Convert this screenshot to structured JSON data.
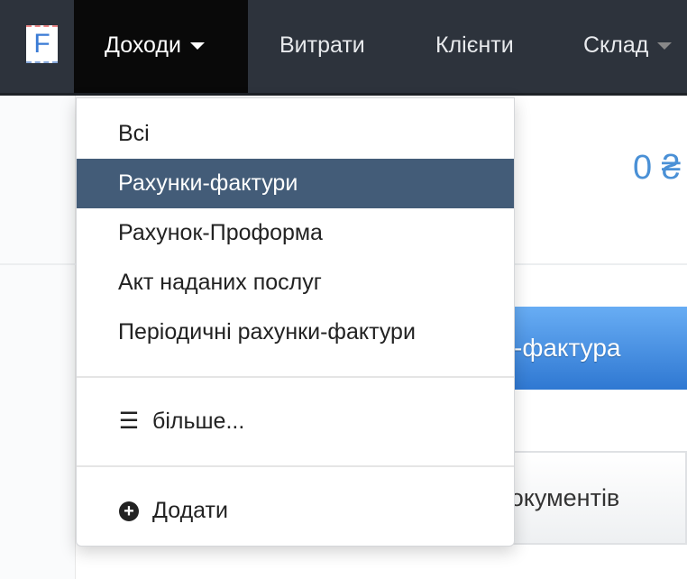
{
  "nav": {
    "logo": "F",
    "items": [
      {
        "label": "Доходи",
        "active": true
      },
      {
        "label": "Витрати"
      },
      {
        "label": "Клієнти"
      },
      {
        "label": "Склад"
      }
    ]
  },
  "background": {
    "amount": "0 ₴",
    "primary_button": "-фактура",
    "secondary_button": "документів"
  },
  "dropdown": {
    "items": [
      "Всі",
      "Рахунки-фактури",
      "Рахунок-Проформа",
      "Акт наданих послуг",
      "Періодичні рахунки-фактури"
    ],
    "selected_index": 1,
    "more": {
      "icon": "list-icon",
      "label": "більше..."
    },
    "add": {
      "icon": "plus-circle-icon",
      "label": "Додати"
    }
  },
  "colors": {
    "navbar": "#2d333c",
    "selected": "#435c78",
    "primary": "#3a84dc"
  }
}
